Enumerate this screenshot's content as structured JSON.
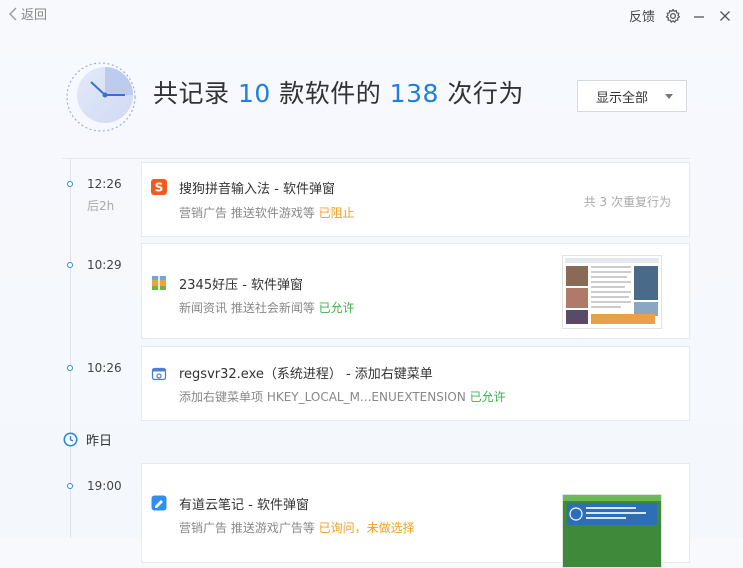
{
  "topbar": {
    "back_label": "返回",
    "feedback_label": "反馈",
    "icons": [
      "chevron-left-icon",
      "gear-icon",
      "minimize-icon",
      "close-icon"
    ]
  },
  "header": {
    "prefix": "共记录 ",
    "software_count": "10",
    "middle": " 款软件的 ",
    "action_count": "138",
    "suffix": " 次行为",
    "filter_label": "显示全部"
  },
  "events": [
    {
      "time": "12:26",
      "ago": "后2h",
      "icon": "sogou-input-icon",
      "title": "搜狗拼音输入法 - 软件弹窗",
      "detail": "营销广告 推送软件游戏等",
      "status": "已阻止",
      "repeat": "共 3 次重复行为"
    },
    {
      "time": "10:29",
      "icon": "2345-archive-icon",
      "title": "2345好压 - 软件弹窗",
      "detail": "新闻资讯 推送社会新闻等",
      "status": "已允许"
    },
    {
      "time": "10:26",
      "icon": "system-process-icon",
      "title": "regsvr32.exe（系统进程） - 添加右键菜单",
      "detail": "添加右键菜单项 HKEY_LOCAL_M...ENUEXTENSION",
      "status": "已允许"
    },
    {
      "time": "19:00",
      "icon": "youdao-note-icon",
      "title": "有道云笔记 - 软件弹窗",
      "detail": "营销广告 推送游戏广告等",
      "status": "已询问，未做选择"
    }
  ],
  "day_divider": {
    "label": "昨日"
  },
  "colors": {
    "accent": "#1f7fdf",
    "blocked": "#f0a020",
    "allowed": "#3db24b"
  }
}
